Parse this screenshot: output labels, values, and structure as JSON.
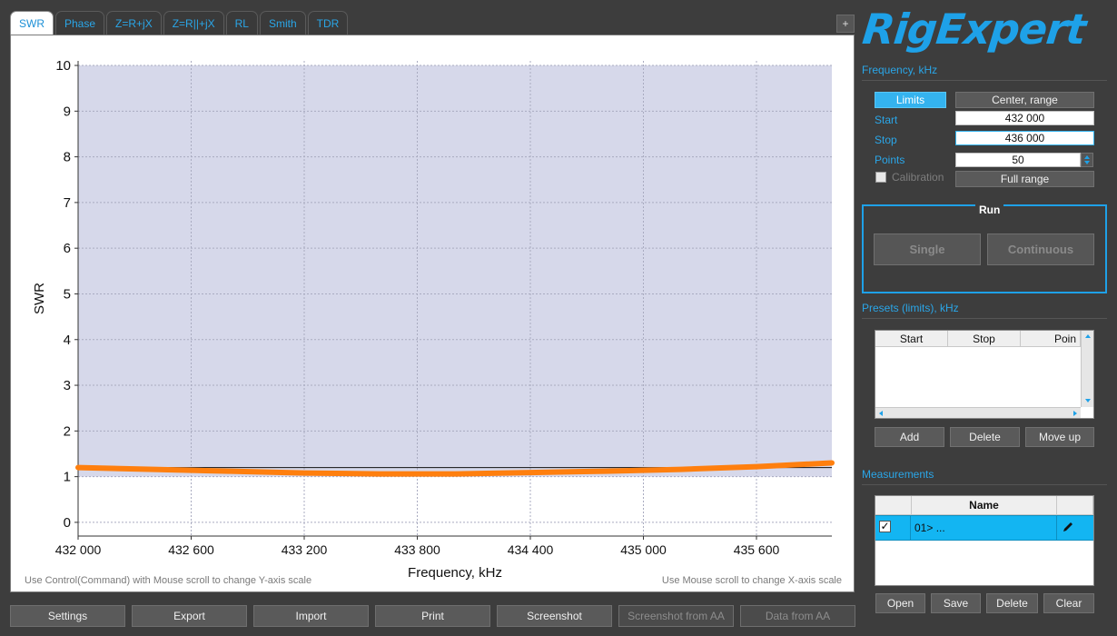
{
  "tabs": [
    "SWR",
    "Phase",
    "Z=R+jX",
    "Z=R||+jX",
    "RL",
    "Smith",
    "TDR"
  ],
  "add_tab_label": "+",
  "chart_data": {
    "type": "line",
    "ylabel": "SWR",
    "xlabel": "Frequency, kHz",
    "ylim": [
      -0.3,
      10.1
    ],
    "xlim": [
      432000,
      436000
    ],
    "y_ticks": [
      "0",
      "1",
      "2",
      "3",
      "4",
      "5",
      "6",
      "7",
      "8",
      "9",
      "10"
    ],
    "x_ticks": [
      "432 000",
      "432 600",
      "433 200",
      "433 800",
      "434 400",
      "435 000",
      "435 600"
    ],
    "x_tick_values": [
      432000,
      432600,
      433200,
      433800,
      434400,
      435000,
      435600
    ],
    "shaded_band": [
      1,
      10
    ],
    "reference_line": 1.2,
    "grid": true,
    "series": [
      {
        "color": "#ff7f0e",
        "x": [
          432000,
          432400,
          432800,
          433200,
          433600,
          434000,
          434400,
          434800,
          435200,
          435600,
          436000
        ],
        "y": [
          1.2,
          1.16,
          1.12,
          1.08,
          1.06,
          1.06,
          1.09,
          1.12,
          1.16,
          1.22,
          1.3
        ]
      }
    ]
  },
  "hints": {
    "left": "Use Control(Command) with Mouse scroll to change Y-axis scale",
    "right": "Use Mouse scroll to change X-axis scale"
  },
  "bottom_buttons": {
    "settings": "Settings",
    "export": "Export",
    "import": "Import",
    "print": "Print",
    "screenshot": "Screenshot",
    "screenshot_aa": "Screenshot from AA",
    "data_aa": "Data from AA"
  },
  "logo_text": "RigExpert",
  "frequency": {
    "section": "Frequency, kHz",
    "limits_btn": "Limits",
    "center_btn": "Center, range",
    "start_label": "Start",
    "start_value": "432 000",
    "stop_label": "Stop",
    "stop_value": "436 000",
    "points_label": "Points",
    "points_value": "50",
    "calibration_label": "Calibration",
    "full_range_btn": "Full range"
  },
  "run": {
    "title": "Run",
    "single": "Single",
    "continuous": "Continuous"
  },
  "presets": {
    "section": "Presets (limits), kHz",
    "columns": [
      "Start",
      "Stop",
      "Poin"
    ],
    "add": "Add",
    "delete": "Delete",
    "move_up": "Move up"
  },
  "measurements": {
    "section": "Measurements",
    "name_header": "Name",
    "row_name": "01> ...",
    "open": "Open",
    "save": "Save",
    "delete": "Delete",
    "clear": "Clear"
  },
  "colors": {
    "accent": "#1ea1e8",
    "band": "#d6d8ea",
    "series": "#ff7f0e",
    "selection": "#13b5f2"
  }
}
